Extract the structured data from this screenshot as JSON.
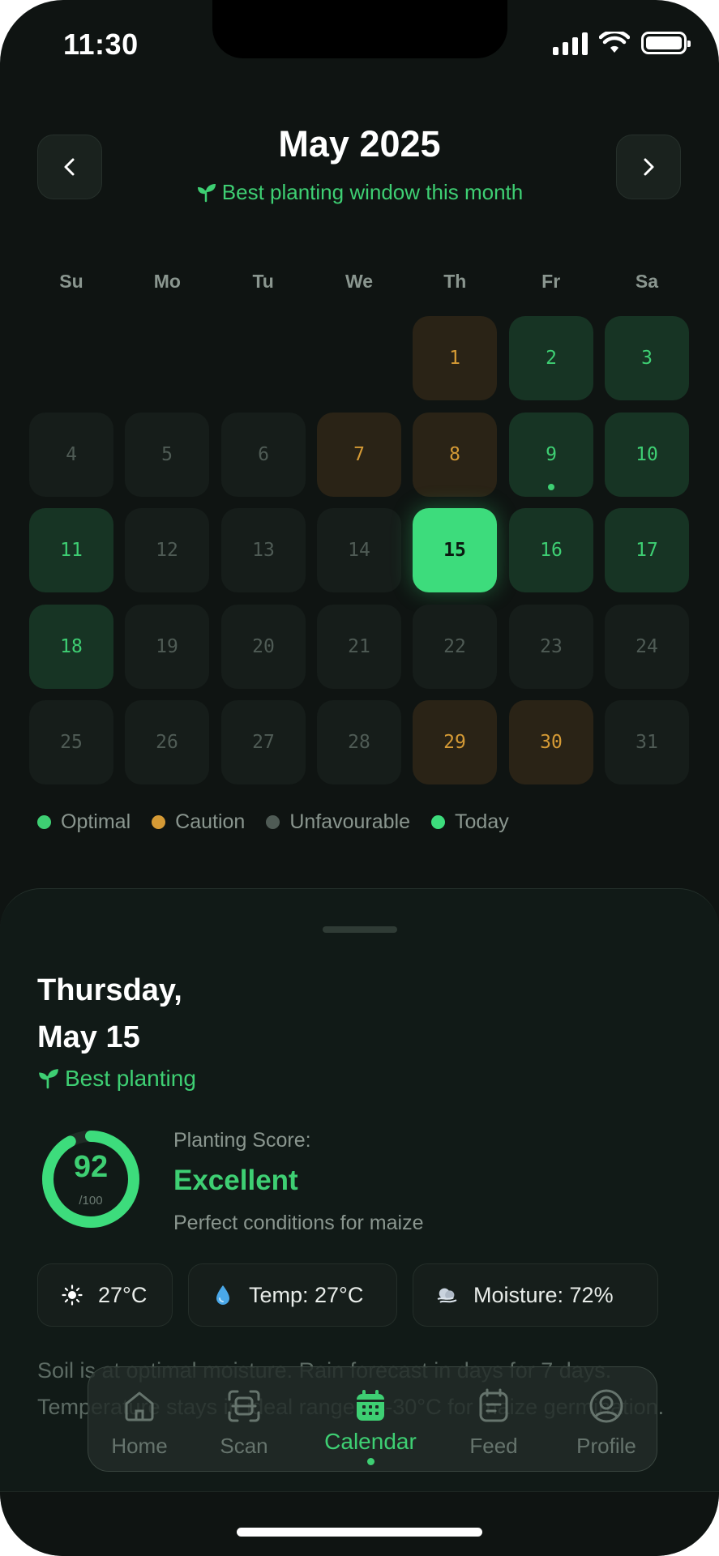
{
  "status_bar": {
    "time": "11:30"
  },
  "header": {
    "month_title": "May 2025",
    "subtitle": "Best planting window this month",
    "prev_icon": "chevron-left-icon",
    "next_icon": "chevron-right-icon"
  },
  "weekdays": [
    "Su",
    "Mo",
    "Tu",
    "We",
    "Th",
    "Fr",
    "Sa"
  ],
  "calendar": {
    "first_weekday_index": 4,
    "days": [
      {
        "n": "1",
        "status": "caution"
      },
      {
        "n": "2",
        "status": "optimal"
      },
      {
        "n": "3",
        "status": "optimal"
      },
      {
        "n": "4",
        "status": "unfavourable"
      },
      {
        "n": "5",
        "status": "unfavourable"
      },
      {
        "n": "6",
        "status": "unfavourable"
      },
      {
        "n": "7",
        "status": "caution"
      },
      {
        "n": "8",
        "status": "caution"
      },
      {
        "n": "9",
        "status": "optimal",
        "event": true
      },
      {
        "n": "10",
        "status": "optimal"
      },
      {
        "n": "11",
        "status": "optimal"
      },
      {
        "n": "12",
        "status": "unfavourable"
      },
      {
        "n": "13",
        "status": "unfavourable"
      },
      {
        "n": "14",
        "status": "unfavourable"
      },
      {
        "n": "15",
        "status": "today"
      },
      {
        "n": "16",
        "status": "optimal"
      },
      {
        "n": "17",
        "status": "optimal"
      },
      {
        "n": "18",
        "status": "optimal"
      },
      {
        "n": "19",
        "status": "unfavourable"
      },
      {
        "n": "20",
        "status": "unfavourable"
      },
      {
        "n": "21",
        "status": "unfavourable"
      },
      {
        "n": "22",
        "status": "unfavourable"
      },
      {
        "n": "23",
        "status": "unfavourable"
      },
      {
        "n": "24",
        "status": "unfavourable"
      },
      {
        "n": "25",
        "status": "unfavourable"
      },
      {
        "n": "26",
        "status": "unfavourable"
      },
      {
        "n": "27",
        "status": "unfavourable"
      },
      {
        "n": "28",
        "status": "unfavourable"
      },
      {
        "n": "29",
        "status": "caution"
      },
      {
        "n": "30",
        "status": "caution"
      },
      {
        "n": "31",
        "status": "unfavourable"
      }
    ]
  },
  "legend": [
    {
      "label": "Optimal",
      "color": "#3ecf73"
    },
    {
      "label": "Caution",
      "color": "#d59a35"
    },
    {
      "label": "Unfavourable",
      "color": "#4f5b55"
    },
    {
      "label": "Today",
      "color": "#3ddc7c"
    }
  ],
  "detail": {
    "day_line": "Thursday,",
    "date_line": "May 15",
    "tag": "Best planting",
    "score_value": "92",
    "score_max": "/100",
    "score_fraction": 0.92,
    "score_label": "Planting Score:",
    "score_grade": "Excellent",
    "score_desc": "Perfect conditions for maize",
    "chips": [
      {
        "icon": "sun-icon",
        "text": "27°C"
      },
      {
        "icon": "droplet-icon",
        "text": "Temp: 27°C"
      },
      {
        "icon": "wind-icon",
        "text": "Moisture: 72%"
      }
    ],
    "soil_text": "Soil is at optimal moisture. Rain forecast in days for 7 days. Temperature stays in ideal range 24-30°C for maize germination."
  },
  "tabbar": {
    "tabs": [
      {
        "label": "Home",
        "icon": "home-icon"
      },
      {
        "label": "Scan",
        "icon": "scan-icon"
      },
      {
        "label": "Calendar",
        "icon": "calendar-icon",
        "active": true
      },
      {
        "label": "Feed",
        "icon": "feed-icon"
      },
      {
        "label": "Profile",
        "icon": "profile-icon"
      }
    ]
  },
  "colors": {
    "accent": "#3ecf73",
    "caution": "#d59a35",
    "background": "#0f1412"
  }
}
